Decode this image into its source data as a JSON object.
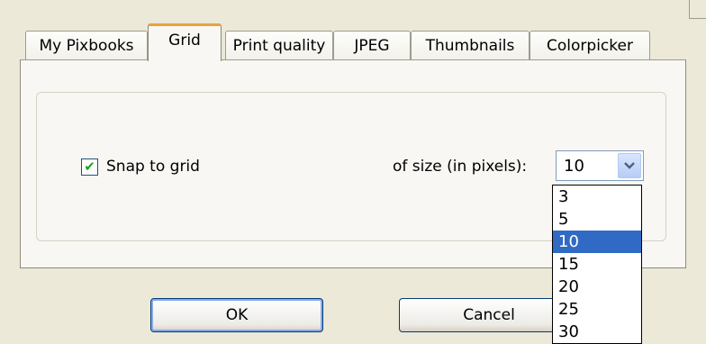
{
  "tabs": [
    {
      "label": "My Pixbooks"
    },
    {
      "label": "Grid"
    },
    {
      "label": "Print quality"
    },
    {
      "label": "JPEG"
    },
    {
      "label": "Thumbnails"
    },
    {
      "label": "Colorpicker"
    }
  ],
  "grid": {
    "snap_checked": true,
    "snap_label": "Snap to grid",
    "size_label": "of size (in pixels):",
    "size_value": "10",
    "size_options": [
      "3",
      "5",
      "10",
      "15",
      "20",
      "25",
      "30"
    ],
    "selected_option": "10"
  },
  "buttons": {
    "ok": "OK",
    "cancel": "Cancel"
  },
  "icons": {
    "check": "checkmark-icon",
    "dropdown": "chevron-down-icon"
  },
  "colors": {
    "selection": "#316ac5",
    "active_tab_accent": "#e8a23a",
    "checkmark": "#21a121"
  }
}
